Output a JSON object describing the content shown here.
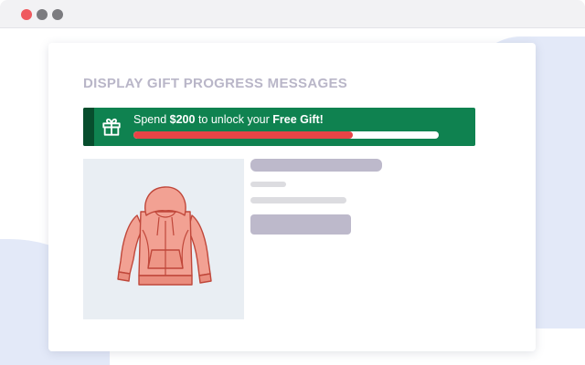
{
  "window": {
    "controls": [
      "close",
      "minimize",
      "maximize"
    ]
  },
  "page": {
    "heading": "DISPLAY GIFT PROGRESS MESSAGES"
  },
  "gift_banner": {
    "icon": "gift-icon",
    "text_prefix": "Spend",
    "amount": "$200",
    "text_middle": "to unlock your",
    "reward": "Free Gift!",
    "progress_fraction": 0.72,
    "colors": {
      "background": "#0f8250",
      "stripe": "#074d2d",
      "progress_fill": "#e84446",
      "progress_track": "#ffffff"
    }
  },
  "product": {
    "image": "hoodie-illustration"
  }
}
